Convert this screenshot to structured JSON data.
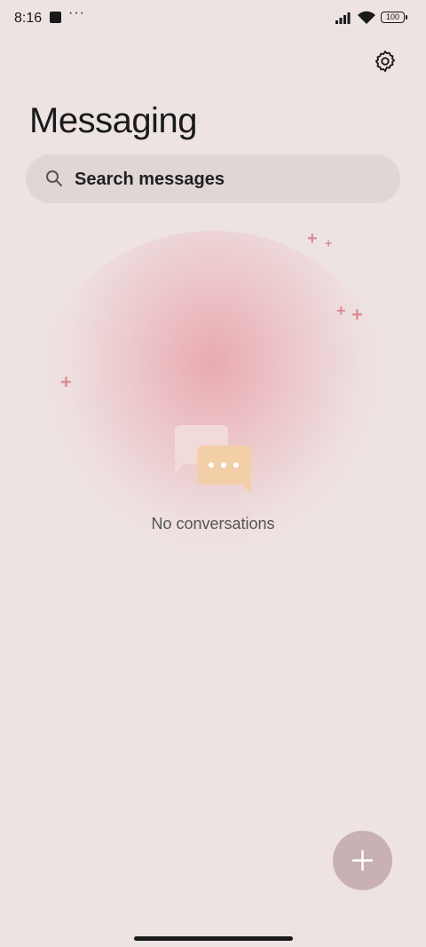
{
  "status_bar": {
    "time": "8:16",
    "dots": "···",
    "battery": "100"
  },
  "header": {
    "title": "Messaging",
    "settings_icon": "gear-icon"
  },
  "search": {
    "label": "Search messages",
    "icon": "search-icon"
  },
  "empty_state": {
    "message": "No conversations",
    "icon": "chat-bubbles-icon"
  },
  "fab": {
    "icon": "plus-icon"
  },
  "colors": {
    "background": "#ede3e3",
    "search_bg": "#e0d6d6",
    "fab_bg": "#c8b0b3",
    "accent_pink": "#d98c95"
  }
}
